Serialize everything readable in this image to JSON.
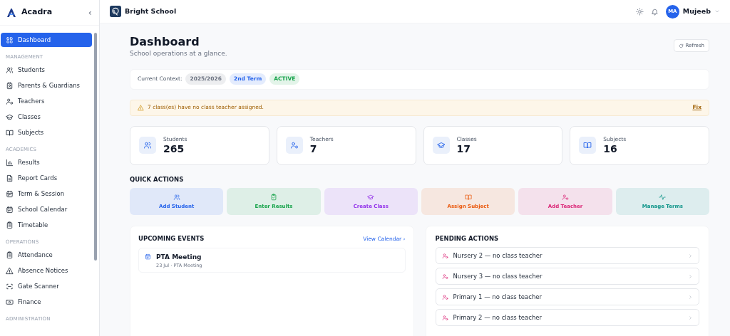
{
  "sidebar": {
    "brand": "Acadra",
    "collapse": "‹",
    "sections": [
      {
        "items": [
          {
            "label": "Dashboard",
            "selected": true
          }
        ]
      },
      {
        "title": "MANAGEMENT",
        "items": [
          {
            "label": "Students",
            "selected": false
          },
          {
            "label": "Parents & Guardians",
            "selected": false
          },
          {
            "label": "Teachers",
            "selected": false
          },
          {
            "label": "Classes",
            "selected": false
          },
          {
            "label": "Subjects",
            "selected": false
          }
        ]
      },
      {
        "title": "ACADEMICS",
        "items": [
          {
            "label": "Results",
            "selected": false
          },
          {
            "label": "Report Cards",
            "selected": false
          },
          {
            "label": "Term & Session",
            "selected": false
          },
          {
            "label": "School Calendar",
            "selected": false
          },
          {
            "label": "Timetable",
            "selected": false
          }
        ]
      },
      {
        "title": "OPERATIONS",
        "items": [
          {
            "label": "Attendance",
            "selected": false
          },
          {
            "label": "Absence Notices",
            "selected": false
          },
          {
            "label": "Gate Scanner",
            "selected": false
          },
          {
            "label": "Finance",
            "selected": false
          }
        ]
      },
      {
        "title": "ADMINISTRATION"
      }
    ]
  },
  "header": {
    "school": "Bright School",
    "user": {
      "initials": "MA",
      "name": "Mujeeb"
    }
  },
  "page": {
    "title": "Dashboard",
    "subtitle": "School operations at a glance.",
    "refresh": "Refresh"
  },
  "context": {
    "label": "Current Context:",
    "badges": [
      {
        "text": "2025/2026",
        "color": "#6b7280"
      },
      {
        "text": "2nd Term",
        "color": "#2563eb"
      },
      {
        "text": "ACTIVE",
        "color": "#16a34a"
      }
    ]
  },
  "alert": {
    "text": "7 class(es) have no class teacher assigned.",
    "action": "Fix"
  },
  "stats": [
    {
      "label": "Students",
      "value": "265"
    },
    {
      "label": "Teachers",
      "value": "7"
    },
    {
      "label": "Classes",
      "value": "17"
    },
    {
      "label": "Subjects",
      "value": "16"
    }
  ],
  "quick_actions": {
    "title": "QUICK ACTIONS",
    "items": [
      {
        "label": "Add Student",
        "color": "#2563eb"
      },
      {
        "label": "Enter Results",
        "color": "#16a34a"
      },
      {
        "label": "Create Class",
        "color": "#9333ea"
      },
      {
        "label": "Assign Subject",
        "color": "#ea580c"
      },
      {
        "label": "Add Teacher",
        "color": "#db2777"
      },
      {
        "label": "Manage Terms",
        "color": "#0d9488"
      }
    ]
  },
  "upcoming_events": {
    "title": "UPCOMING EVENTS",
    "link": "View Calendar ›",
    "events": [
      {
        "title": "PTA Meeting",
        "detail": "23 Jul · PTA Meeting"
      }
    ]
  },
  "pending_actions": {
    "title": "PENDING ACTIONS",
    "items": [
      {
        "text": "Nursery 2 — no class teacher"
      },
      {
        "text": "Nursery 3 — no class teacher"
      },
      {
        "text": "Primary 1 — no class teacher"
      },
      {
        "text": "Primary 2 — no class teacher"
      }
    ]
  }
}
